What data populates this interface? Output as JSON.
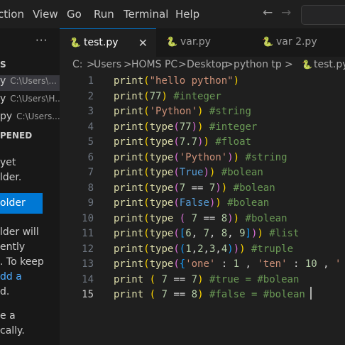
{
  "menu": {
    "items": [
      "ction",
      "View",
      "Go",
      "Run",
      "Terminal",
      "Help"
    ],
    "back_arrow": "←",
    "forward_arrow": "→"
  },
  "sidebar": {
    "more": "···",
    "section_fragment": "S",
    "files": [
      {
        "name": "y",
        "path": "C:\\Users\\..."
      },
      {
        "name": "y",
        "path": "C:\\Users\\H..."
      },
      {
        "name": "py",
        "path": "C:\\Users..."
      }
    ],
    "opened_header": "PENED",
    "text_lines": [
      "yet",
      "lder."
    ],
    "button_label": "older",
    "info_lines": [
      "lder will",
      "ently",
      ". To keep",
      "dd a",
      "d.",
      "e a",
      "cally."
    ],
    "link_fragment": "dd a"
  },
  "tabs": [
    {
      "name": "test.py",
      "active": true,
      "close": "✕"
    },
    {
      "name": "var.py",
      "active": false
    },
    {
      "name": "var 2.py",
      "active": false
    }
  ],
  "breadcrumb": [
    "C:",
    ">",
    "Users",
    ">",
    "HOMS PC",
    ">",
    "Desktop",
    ">",
    "python tp",
    ">",
    "test.py"
  ],
  "editor": {
    "current_line": 15,
    "lines": [
      {
        "n": "1",
        "text": "print(\"hello python\")"
      },
      {
        "n": "2",
        "text": "print(77) #integer"
      },
      {
        "n": "3",
        "text": "print('Python') #string"
      },
      {
        "n": "4",
        "text": "print(type(77)) #integer"
      },
      {
        "n": "5",
        "text": "print(type(7.7)) #float"
      },
      {
        "n": "6",
        "text": "print(type('Python')) #string"
      },
      {
        "n": "7",
        "text": "print(type(True)) #bolean"
      },
      {
        "n": "8",
        "text": "print(type(7 == 7)) #bolean"
      },
      {
        "n": "9",
        "text": "print(type(False)) #bolean"
      },
      {
        "n": "10",
        "text": "print(type ( 7 == 8)) #bolean"
      },
      {
        "n": "11",
        "text": "print(type([6, 7, 8, 9])) #list"
      },
      {
        "n": "12",
        "text": "print(type((1,2,3,4))) #truple"
      },
      {
        "n": "13",
        "text": "print(type({'one' : 1 , 'ten' : 10 , '"
      },
      {
        "n": "14",
        "text": "print ( 7 == 7) #true = #bolean"
      },
      {
        "n": "15",
        "text": "print ( 7 == 8) #false = #bolean"
      }
    ]
  },
  "colors": {
    "accent": "#0078d4",
    "editor_bg": "#1f1f1f",
    "sidebar_bg": "#181818",
    "function": "#dcdcaa",
    "string": "#ce9178",
    "number": "#b5cea8",
    "comment": "#6a9955"
  }
}
